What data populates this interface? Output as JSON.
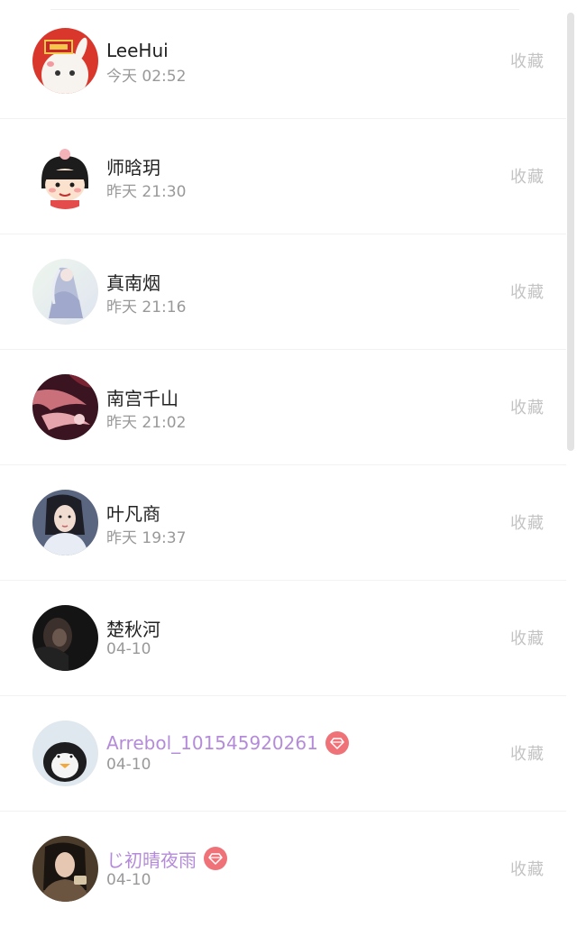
{
  "visitors": [
    {
      "name": "LeeHui",
      "time": "今天 02:52",
      "action": "收藏",
      "vip": false,
      "avatar": "avatar-cartoon-red"
    },
    {
      "name": "师晗玥",
      "time": "昨天 21:30",
      "action": "收藏",
      "vip": false,
      "avatar": "avatar-cartoon-girl"
    },
    {
      "name": "真南烟",
      "time": "昨天 21:16",
      "action": "收藏",
      "vip": false,
      "avatar": "avatar-anime-white"
    },
    {
      "name": "南宫千山",
      "time": "昨天 21:02",
      "action": "收藏",
      "vip": false,
      "avatar": "avatar-anime-dark"
    },
    {
      "name": "叶凡商",
      "time": "昨天 19:37",
      "action": "收藏",
      "vip": false,
      "avatar": "avatar-portrait-lady"
    },
    {
      "name": "楚秋河",
      "time": "04-10",
      "action": "收藏",
      "vip": false,
      "avatar": "avatar-dark-photo"
    },
    {
      "name": "Arrebol_101545920261",
      "time": "04-10",
      "action": "收藏",
      "vip": true,
      "avatar": "avatar-penguin"
    },
    {
      "name": "じ初晴夜雨",
      "time": "04-10",
      "action": "收藏",
      "vip": true,
      "avatar": "avatar-girl-photo"
    }
  ],
  "colors": {
    "vip_name": "#b48bd9",
    "vip_badge": "#ef7279",
    "fav_text": "#c3c3c3",
    "time_text": "#999999"
  },
  "icons": {
    "vip_badge": "diamond-icon"
  }
}
